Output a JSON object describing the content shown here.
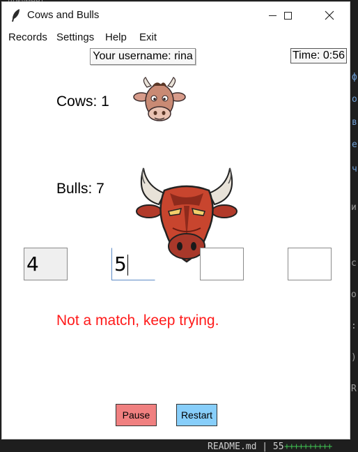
{
  "window": {
    "title": "Cows and Bulls"
  },
  "menu": [
    "Records",
    "Settings",
    "Help",
    "Exit"
  ],
  "header": {
    "username": "Your username: rina",
    "time": "Time: 0:56"
  },
  "stats": {
    "cows": "Cows: 1",
    "bulls": "Bulls: 7"
  },
  "digits": [
    "4",
    "5",
    "",
    ""
  ],
  "status": {
    "message": "Not a match, keep trying."
  },
  "buttons": {
    "pause": "Pause",
    "restart": "Restart"
  },
  "background": {
    "readme": "README.md | 55",
    "plus": "++++++++++"
  },
  "colors": {
    "status": "#ff1a1a",
    "pause_bg": "#f08080",
    "restart_bg": "#87cefa"
  }
}
